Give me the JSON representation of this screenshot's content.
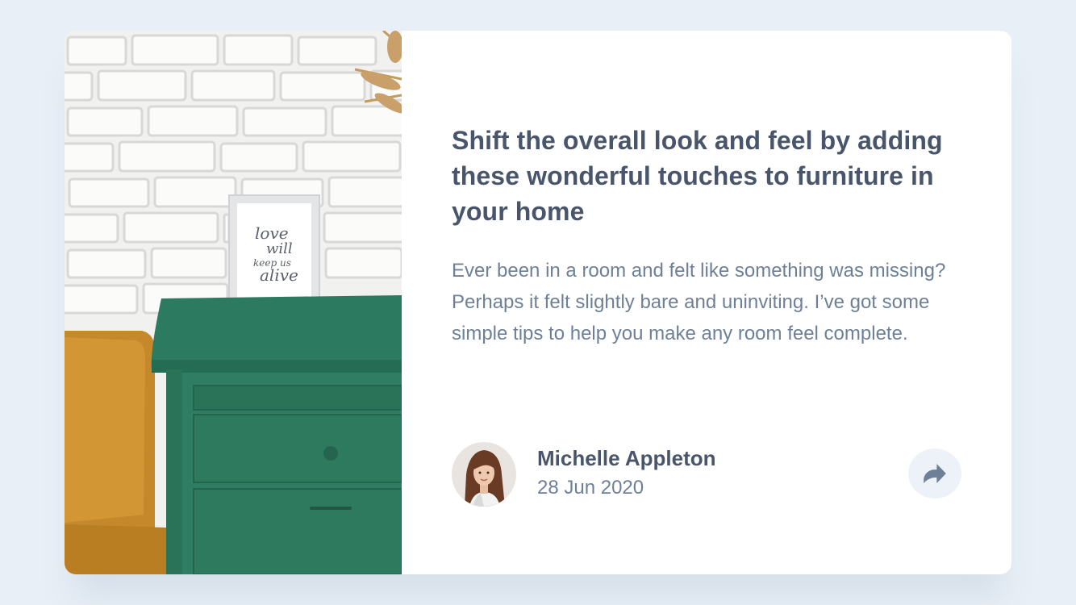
{
  "card": {
    "image_alt": "Green drawers with a framed print reading love will keep us alive",
    "frame_text": [
      "love",
      "will",
      "keep us",
      "alive"
    ],
    "headline": "Shift the overall look and feel by adding these wonderful touches to furniture in your home",
    "excerpt": "Ever been in a room and felt like something was missing? Perhaps it felt slightly bare and uninviting. I’ve got some simple tips to help you make any room feel complete.",
    "author": {
      "name": "Michelle Appleton",
      "date": "28 Jun 2020",
      "avatar_icon": "avatar-portrait"
    },
    "share": {
      "icon": "share-arrow-icon"
    }
  },
  "colors": {
    "page_bg": "#e9eff7",
    "card_bg": "#ffffff",
    "heading": "#48556a",
    "body_text": "#6e8098",
    "share_bg": "#ecf2f8",
    "share_icon": "#6e8098",
    "dresser_green": "#2f7d62"
  }
}
